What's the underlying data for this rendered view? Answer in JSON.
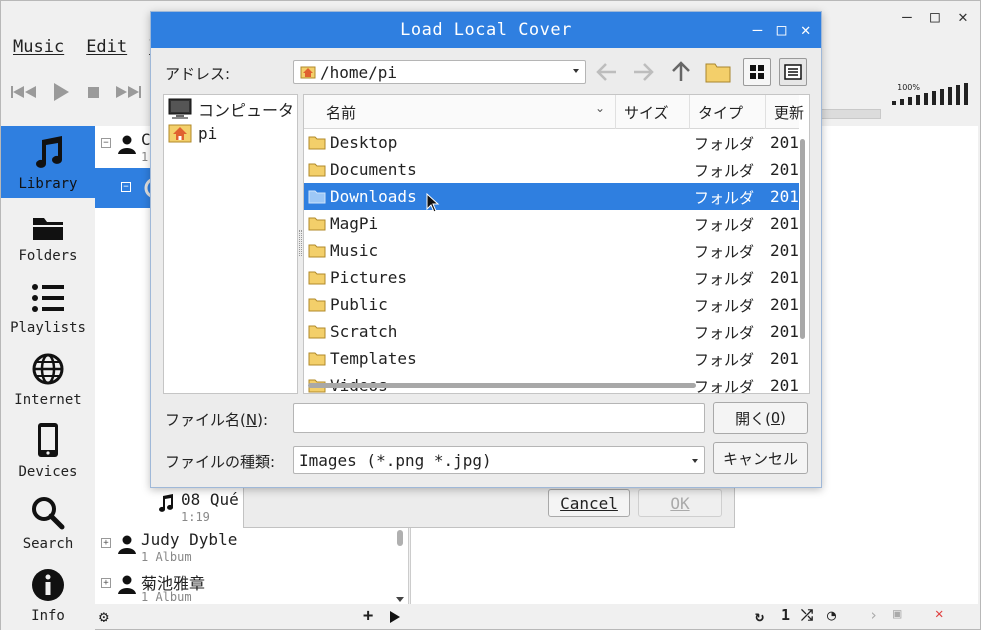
{
  "main": {
    "menu": [
      {
        "label": "Music"
      },
      {
        "label": "Edit"
      },
      {
        "label": "V"
      }
    ],
    "volume_label": "100%",
    "sidebar": [
      {
        "label": "Library",
        "icon": "music-note-icon",
        "active": true
      },
      {
        "label": "Folders",
        "icon": "folder-icon"
      },
      {
        "label": "Playlists",
        "icon": "list-icon"
      },
      {
        "label": "Internet",
        "icon": "globe-icon"
      },
      {
        "label": "Devices",
        "icon": "phone-icon"
      },
      {
        "label": "Search",
        "icon": "magnifier-icon"
      },
      {
        "label": "Info",
        "icon": "info-icon"
      }
    ],
    "library": {
      "top_artist": {
        "name": "C",
        "sub": "1"
      },
      "track": {
        "name": "08 Qué",
        "duration": "1:19"
      },
      "artists": [
        {
          "name": "Judy Dyble",
          "sub": "1 Album"
        },
        {
          "name": "菊池雅章",
          "sub": "1 Album"
        }
      ]
    },
    "bottom_right_number": "1"
  },
  "bg_dialog": {
    "cancel_label": "Cancel",
    "ok_label": "OK"
  },
  "dialog": {
    "title": "Load Local Cover",
    "address_label": "アドレス:",
    "address_value": "/home/pi",
    "places": [
      {
        "label": "コンピュータ",
        "icon": "computer-icon"
      },
      {
        "label": "pi",
        "icon": "home-folder-icon"
      }
    ],
    "columns": {
      "name": "名前",
      "size": "サイズ",
      "type": "タイプ",
      "date": "更新"
    },
    "files": [
      {
        "name": "Desktop",
        "type": "フォルダ",
        "date": "201"
      },
      {
        "name": "Documents",
        "type": "フォルダ",
        "date": "201"
      },
      {
        "name": "Downloads",
        "type": "フォルダ",
        "date": "201",
        "selected": true
      },
      {
        "name": "MagPi",
        "type": "フォルダ",
        "date": "201"
      },
      {
        "name": "Music",
        "type": "フォルダ",
        "date": "201"
      },
      {
        "name": "Pictures",
        "type": "フォルダ",
        "date": "201"
      },
      {
        "name": "Public",
        "type": "フォルダ",
        "date": "201"
      },
      {
        "name": "Scratch",
        "type": "フォルダ",
        "date": "201"
      },
      {
        "name": "Templates",
        "type": "フォルダ",
        "date": "201"
      },
      {
        "name": "Videos",
        "type": "フォルダ",
        "date": "201"
      }
    ],
    "filename_label_pre": "ファイル名(",
    "filename_label_key": "N",
    "filename_label_post": "):",
    "filename_value": "",
    "open_label_pre": "開く(",
    "open_label_key": "O",
    "open_label_post": ")",
    "filetype_label": "ファイルの種類:",
    "filetype_value": "Images (*.png *.jpg)",
    "cancel_label": "キャンセル"
  },
  "colors": {
    "accent": "#2f7fe0",
    "folder": "#f3cf6a"
  }
}
